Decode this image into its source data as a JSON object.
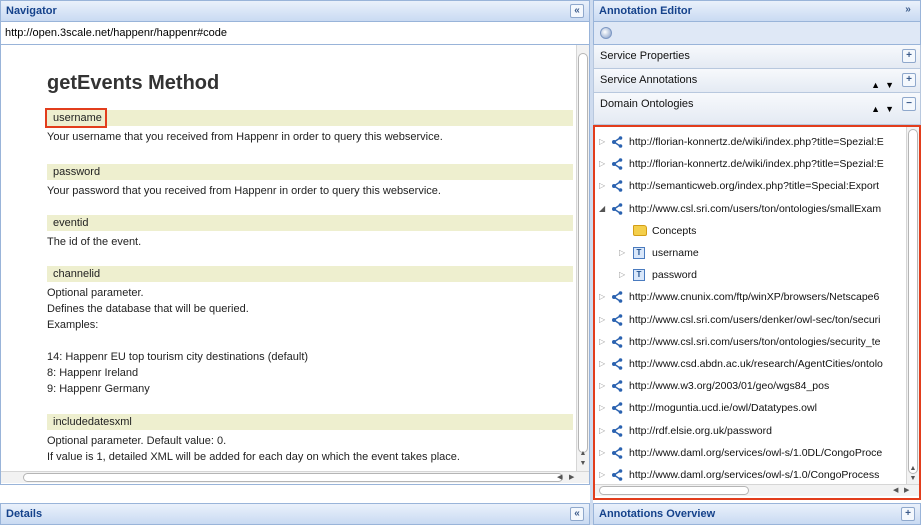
{
  "navigator": {
    "title": "Navigator",
    "collapse_icon": "double-chevron-up-icon",
    "url": "http://open.3scale.net/happenr/happenr#code",
    "method_title": "getEvents Method",
    "params": [
      {
        "name": "username",
        "desc": [
          "Your username that you received from Happenr in order to query this webservice."
        ]
      },
      {
        "name": "password",
        "desc": [
          "Your password that you received from Happenr in order to query this webservice."
        ]
      },
      {
        "name": "eventid",
        "desc": [
          "The id of the event."
        ]
      },
      {
        "name": "channelid",
        "desc": [
          "Optional parameter.",
          "Defines the database that will be queried.",
          "Examples:",
          "",
          "14: Happenr EU top tourism city destinations (default)",
          "8: Happenr Ireland",
          "9: Happenr Germany"
        ]
      },
      {
        "name": "includedatesxml",
        "desc": [
          "Optional parameter. Default value: 0.",
          "If value is 1, detailed XML will be added for each day on which the event takes place."
        ]
      }
    ]
  },
  "details": {
    "title": "Details",
    "collapse_icon": "double-chevron-up-icon"
  },
  "annotation_editor": {
    "title": "Annotation Editor",
    "expand_icon": "double-chevron-right-icon",
    "sections": {
      "service_properties": "Service Properties",
      "service_annotations": "Service Annotations",
      "domain_ontologies": "Domain Ontologies"
    },
    "ontologies": [
      {
        "label": "http://florian-konnertz.de/wiki/index.php?title=Spezial:E",
        "expanded": false
      },
      {
        "label": "http://florian-konnertz.de/wiki/index.php?title=Spezial:E",
        "expanded": false
      },
      {
        "label": "http://semanticweb.org/index.php?title=Special:Export",
        "expanded": false
      },
      {
        "label": "http://www.csl.sri.com/users/ton/ontologies/smallExam",
        "expanded": true
      },
      {
        "label": "Concepts",
        "kind": "folder"
      },
      {
        "label": "username",
        "kind": "type"
      },
      {
        "label": "password",
        "kind": "type"
      },
      {
        "label": "http://www.cnunix.com/ftp/winXP/browsers/Netscape6",
        "expanded": false
      },
      {
        "label": "http://www.csl.sri.com/users/denker/owl-sec/ton/securi",
        "expanded": false
      },
      {
        "label": "http://www.csl.sri.com/users/ton/ontologies/security_te",
        "expanded": false
      },
      {
        "label": "http://www.csd.abdn.ac.uk/research/AgentCities/ontolo",
        "expanded": false
      },
      {
        "label": "http://www.w3.org/2003/01/geo/wgs84_pos",
        "expanded": false
      },
      {
        "label": "http://moguntia.ucd.ie/owl/Datatypes.owl",
        "expanded": false
      },
      {
        "label": "http://rdf.elsie.org.uk/password",
        "expanded": false
      },
      {
        "label": "http://www.daml.org/services/owl-s/1.0DL/CongoProce",
        "expanded": false
      },
      {
        "label": "http://www.daml.org/services/owl-s/1.0/CongoProcess",
        "expanded": false
      }
    ],
    "type_badge": "T",
    "overview_title": "Annotations Overview",
    "plus": "+",
    "minus": "−"
  },
  "colors": {
    "highlight": "#e23d1c",
    "header_text": "#15428b",
    "param_bg": "#eeefcf"
  }
}
